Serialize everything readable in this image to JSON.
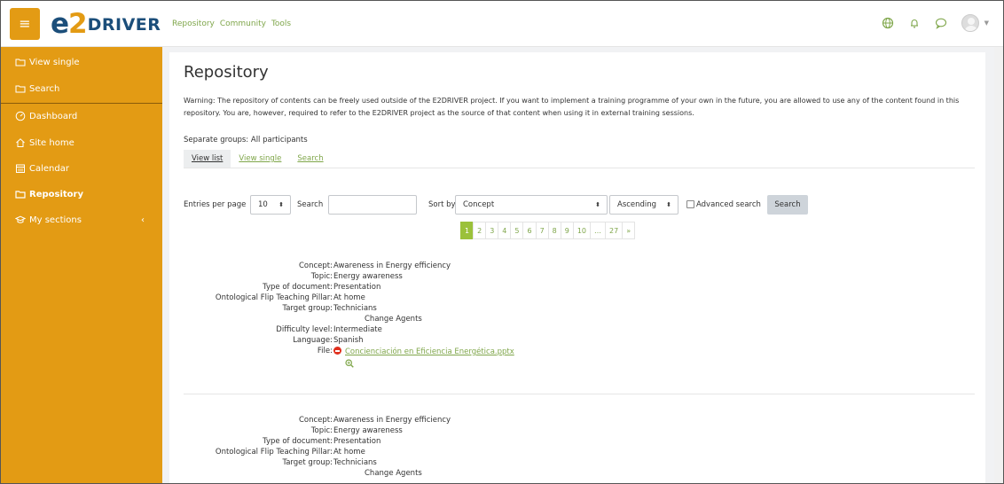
{
  "header": {
    "menu_icon": "hamburger-icon",
    "logo": {
      "part1": "e",
      "part2": "2",
      "part3": "DRIVER"
    },
    "nav": [
      "Repository",
      "Community",
      "Tools"
    ],
    "icons": [
      "globe-icon",
      "bell-icon",
      "chat-icon",
      "avatar",
      "chevron-down-icon"
    ]
  },
  "sidebar": {
    "items": [
      {
        "label": "View single",
        "icon": "folder-icon"
      },
      {
        "label": "Search",
        "icon": "folder-icon"
      },
      {
        "label": "Dashboard",
        "icon": "dashboard-icon"
      },
      {
        "label": "Site home",
        "icon": "home-icon"
      },
      {
        "label": "Calendar",
        "icon": "calendar-icon"
      },
      {
        "label": "Repository",
        "icon": "folder-icon",
        "active": true
      },
      {
        "label": "My sections",
        "icon": "graduation-cap-icon"
      }
    ],
    "collapse_glyph": "‹"
  },
  "main": {
    "title": "Repository",
    "warning": "Warning: The repository of contents can be freely used outside of the E2DRIVER project. If you want to implement a training programme of your own in the future, you are allowed to use any of the content found in this repository. You are, however, required to refer to the E2DRIVER project as the source of that content when using it in external training sessions.",
    "groups": "Separate groups: All participants",
    "tabs": [
      "View list",
      "View single",
      "Search"
    ],
    "controls": {
      "entries_label": "Entries per page",
      "entries_value": "10",
      "search_label": "Search",
      "search_value": "",
      "sort_label": "Sort by",
      "sort_value": "Concept",
      "order_value": "Ascending",
      "advanced_label": "Advanced search",
      "search_button": "Search",
      "select_arrow": "⬍"
    },
    "pagination": [
      "1",
      "2",
      "3",
      "4",
      "5",
      "6",
      "7",
      "8",
      "9",
      "10",
      "…",
      "27",
      "»"
    ],
    "records": [
      {
        "concept_label": "Concept:",
        "concept": "Awareness in Energy efficiency",
        "topic_label": "Topic:",
        "topic": "Energy awareness",
        "type_label": "Type of document:",
        "type": "Presentation",
        "pillar_label": "Ontological Flip Teaching Pillar:",
        "pillar": "At home",
        "target_label": "Target group:",
        "target1": "Technicians",
        "target2": "Change Agents",
        "difficulty_label": "Difficulty level:",
        "difficulty": "Intermediate",
        "language_label": "Language:",
        "language": "Spanish",
        "file_label": "File:",
        "file": "Concienciación en Eficiencia Energética.pptx"
      },
      {
        "concept_label": "Concept:",
        "concept": "Awareness in Energy efficiency",
        "topic_label": "Topic:",
        "topic": "Energy awareness",
        "type_label": "Type of document:",
        "type": "Presentation",
        "pillar_label": "Ontological Flip Teaching Pillar:",
        "pillar": "At home",
        "target_label": "Target group:",
        "target1": "Technicians",
        "target2": "Change Agents"
      }
    ]
  },
  "colors": {
    "sidebar": "#e39b14",
    "brand_blue": "#1b4e7a",
    "link_green": "#7fa64a",
    "page_active": "#9bc13a"
  }
}
